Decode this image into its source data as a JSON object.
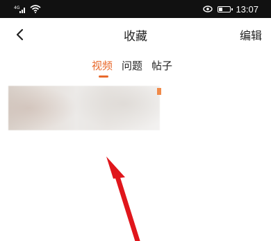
{
  "status_bar": {
    "signal_text": "4G",
    "time": "13:07"
  },
  "header": {
    "title": "收藏",
    "edit_label": "编辑"
  },
  "tabs": [
    {
      "label": "视频",
      "active": true
    },
    {
      "label": "问题",
      "active": false
    },
    {
      "label": "帖子",
      "active": false
    }
  ],
  "colors": {
    "accent": "#e8692c",
    "annotation_arrow": "#e0161c"
  },
  "battery_level": 0.3
}
